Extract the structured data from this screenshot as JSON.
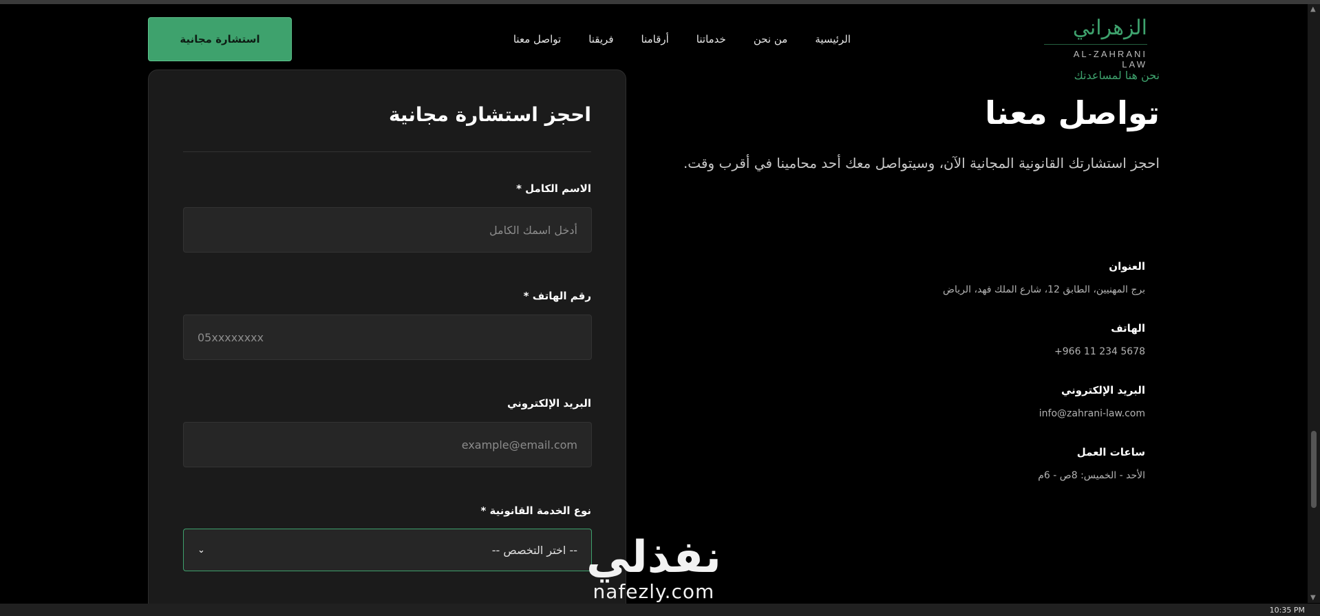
{
  "header": {
    "logo_ar": "الزهراني",
    "logo_en": "AL-ZAHRANI LAW",
    "nav": [
      "الرئيسية",
      "من نحن",
      "خدماتنا",
      "أرقامنا",
      "فريقنا",
      "تواصل معنا"
    ],
    "cta": "استشارة مجانية"
  },
  "info": {
    "kicker": "نحن هنا لمساعدتك",
    "title": "تواصل معنا",
    "lead": "احجز استشارتك القانونية المجانية الآن، وسيتواصل معك أحد محامينا في أقرب وقت.",
    "items": [
      {
        "label": "العنوان",
        "value": "برج المهنيين، الطابق 12، شارع الملك فهد، الرياض"
      },
      {
        "label": "الهاتف",
        "value": "+966 11 234 5678"
      },
      {
        "label": "البريد الإلكتروني",
        "value": "info@zahrani-law.com"
      },
      {
        "label": "ساعات العمل",
        "value": "الأحد - الخميس: 8ص - 6م"
      }
    ]
  },
  "form": {
    "title": "احجز استشارة مجانية",
    "name_label": "الاسم الكامل *",
    "name_placeholder": "أدخل اسمك الكامل",
    "phone_label": "رقم الهاتف *",
    "phone_placeholder": "05xxxxxxxx",
    "email_label": "البريد الإلكتروني",
    "email_placeholder": "example@email.com",
    "service_label": "نوع الخدمة القانونية *",
    "service_value": "-- اختر التخصص --"
  },
  "watermark": {
    "ar": "نفذلي",
    "en": "nafezly.com"
  },
  "taskbar": {
    "clock": "10:35 PM"
  }
}
